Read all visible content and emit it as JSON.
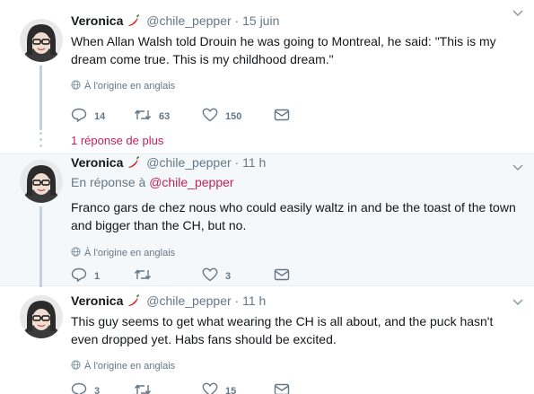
{
  "tweets": [
    {
      "name": "Veronica",
      "handle": "@chile_pepper",
      "sep": "·",
      "time": "15 juin",
      "text": "When Allan Walsh told Drouin he was going to Montreal, he said: \"This is my dream come true. This is my childhood dream.\"",
      "translation": "À l'origine en anglais",
      "reply_count": "14",
      "retweet_count": "63",
      "like_count": "150"
    },
    {
      "name": "Veronica",
      "handle": "@chile_pepper",
      "sep": "·",
      "time": "11 h",
      "reply_prefix": "En réponse à",
      "reply_mention": "@chile_pepper",
      "text": "Franco gars de chez nous who could easily waltz in and be the toast of the town and bigger than the CH, but no.",
      "translation": "À l'origine en anglais",
      "reply_count": "1",
      "retweet_count": "",
      "like_count": "3"
    },
    {
      "name": "Veronica",
      "handle": "@chile_pepper",
      "sep": "·",
      "time": "11 h",
      "text": "This guy seems to get what wearing the CH is all about, and the puck hasn't even dropped yet. Habs fans should be excited.",
      "translation": "À l'origine en anglais",
      "reply_count": "3",
      "retweet_count": "",
      "like_count": "15"
    }
  ],
  "more_replies": "1 réponse de plus",
  "icons": {
    "reply": "reply-icon",
    "retweet": "retweet-icon",
    "like": "heart-icon",
    "dm": "envelope-icon",
    "globe": "globe-icon",
    "chevron": "chevron-down-icon",
    "pepper": "chili-pepper-icon"
  },
  "colors": {
    "link": "#c0215e",
    "muted": "#657786",
    "thread": "#c5d1da",
    "highlight_bg": "#f5f8fa"
  }
}
